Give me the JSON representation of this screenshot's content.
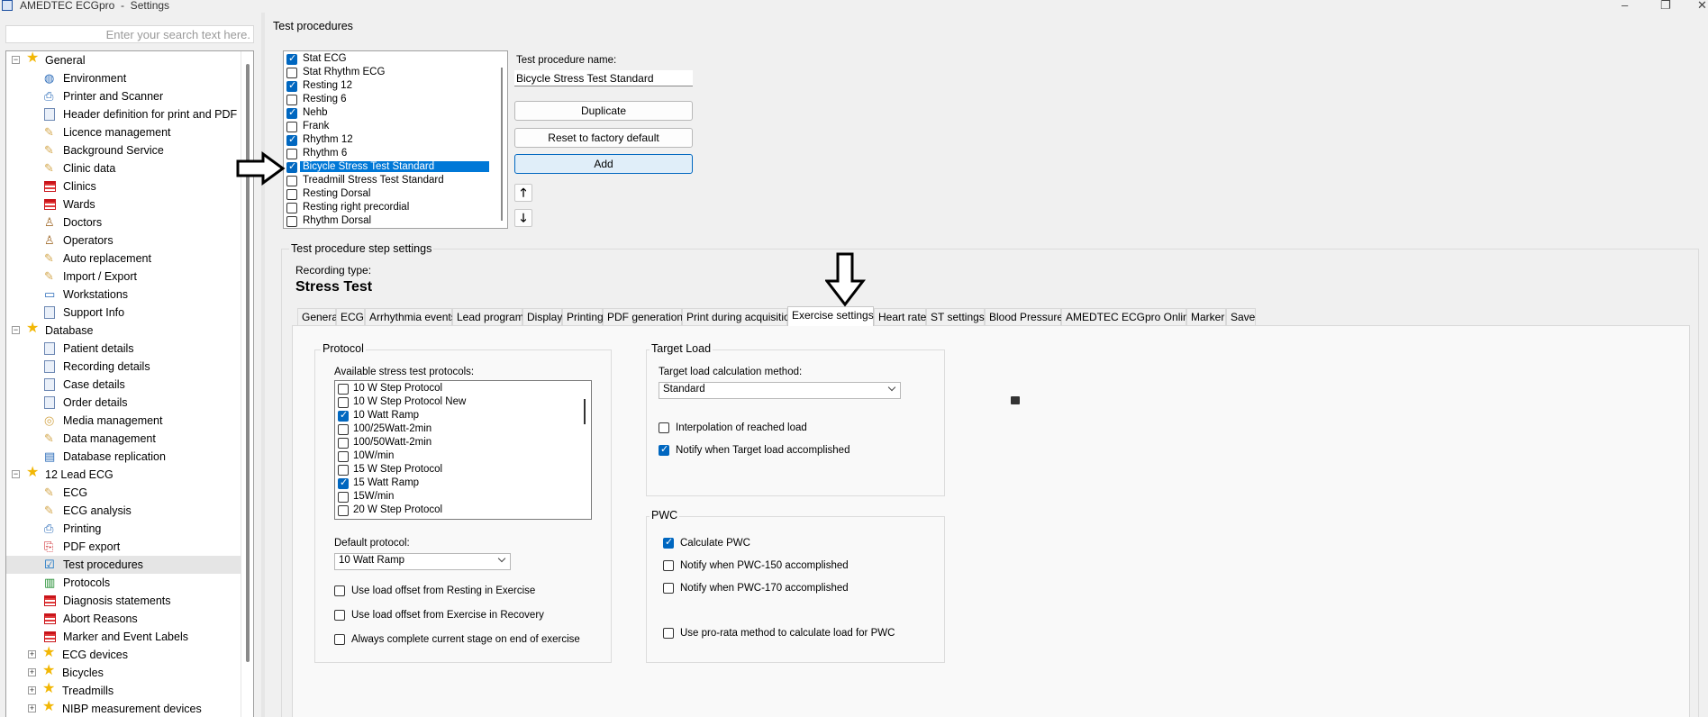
{
  "window": {
    "title": "AMEDTEC ECGpro  -  Settings",
    "controls": [
      "–",
      "❐",
      "✕"
    ]
  },
  "search": {
    "placeholder": "Enter your search text here."
  },
  "tree": {
    "items": [
      {
        "label": "General",
        "icon": "star-icon",
        "level": 0,
        "expander": "−"
      },
      {
        "label": "Environment",
        "icon": "globe-icon",
        "level": 1
      },
      {
        "label": "Printer and Scanner",
        "icon": "printer-icon",
        "level": 1
      },
      {
        "label": "Header definition for print and PDF",
        "icon": "document-icon",
        "level": 1
      },
      {
        "label": "Licence management",
        "icon": "pencil-icon",
        "level": 1
      },
      {
        "label": "Background Service",
        "icon": "pencil-icon",
        "level": 1
      },
      {
        "label": "Clinic data",
        "icon": "pencil-icon",
        "level": 1
      },
      {
        "label": "Clinics",
        "icon": "table-icon",
        "level": 1
      },
      {
        "label": "Wards",
        "icon": "table-icon",
        "level": 1
      },
      {
        "label": "Doctors",
        "icon": "person-icon",
        "level": 1
      },
      {
        "label": "Operators",
        "icon": "person-icon",
        "level": 1
      },
      {
        "label": "Auto replacement",
        "icon": "pencil-icon",
        "level": 1
      },
      {
        "label": "Import / Export",
        "icon": "pencil-icon",
        "level": 1
      },
      {
        "label": "Workstations",
        "icon": "monitor-icon",
        "level": 1
      },
      {
        "label": "Support Info",
        "icon": "document-icon",
        "level": 1
      },
      {
        "label": "Database",
        "icon": "star-icon",
        "level": 0,
        "expander": "−"
      },
      {
        "label": "Patient details",
        "icon": "document-icon",
        "level": 1
      },
      {
        "label": "Recording details",
        "icon": "document-icon",
        "level": 1
      },
      {
        "label": "Case details",
        "icon": "document-icon",
        "level": 1
      },
      {
        "label": "Order details",
        "icon": "document-icon",
        "level": 1
      },
      {
        "label": "Media management",
        "icon": "disc-icon",
        "level": 1
      },
      {
        "label": "Data management",
        "icon": "tool-icon",
        "level": 1
      },
      {
        "label": "Database replication",
        "icon": "database-icon",
        "level": 1
      },
      {
        "label": "12 Lead ECG",
        "icon": "star-icon",
        "level": 0,
        "expander": "−"
      },
      {
        "label": "ECG",
        "icon": "tool-icon",
        "level": 1
      },
      {
        "label": "ECG analysis",
        "icon": "tool-icon",
        "level": 1
      },
      {
        "label": "Printing",
        "icon": "printer-icon",
        "level": 1
      },
      {
        "label": "PDF export",
        "icon": "pdf-icon",
        "level": 1
      },
      {
        "label": "Test procedures",
        "icon": "checklist-icon",
        "level": 1,
        "selected": true
      },
      {
        "label": "Protocols",
        "icon": "chart-icon",
        "level": 1
      },
      {
        "label": "Diagnosis statements",
        "icon": "table-icon",
        "level": 1
      },
      {
        "label": "Abort Reasons",
        "icon": "table-icon",
        "level": 1
      },
      {
        "label": "Marker and Event Labels",
        "icon": "table-icon",
        "level": 1
      },
      {
        "label": "ECG devices",
        "icon": "star-icon",
        "level": 0,
        "expander": "+"
      },
      {
        "label": "Bicycles",
        "icon": "star-icon",
        "level": 0,
        "expander": "+"
      },
      {
        "label": "Treadmills",
        "icon": "star-icon",
        "level": 0,
        "expander": "+"
      },
      {
        "label": "NIBP measurement devices",
        "icon": "star-icon",
        "level": 0,
        "expander": "+"
      }
    ]
  },
  "test_procedures": {
    "group_title": "Test procedures",
    "items": [
      {
        "label": "Stat ECG",
        "checked": true
      },
      {
        "label": "Stat Rhythm ECG",
        "checked": false
      },
      {
        "label": "Resting 12",
        "checked": true
      },
      {
        "label": "Resting 6",
        "checked": false
      },
      {
        "label": "Nehb",
        "checked": true
      },
      {
        "label": "Frank",
        "checked": false
      },
      {
        "label": "Rhythm 12",
        "checked": true
      },
      {
        "label": "Rhythm 6",
        "checked": false
      },
      {
        "label": "Bicycle Stress Test Standard",
        "checked": true,
        "selected": true
      },
      {
        "label": "Treadmill Stress Test Standard",
        "checked": false
      },
      {
        "label": "Resting Dorsal",
        "checked": false
      },
      {
        "label": "Resting right precordial",
        "checked": false
      },
      {
        "label": "Rhythm Dorsal",
        "checked": false
      }
    ],
    "name_label": "Test procedure name:",
    "name_value": "Bicycle Stress Test Standard",
    "duplicate_label": "Duplicate",
    "reset_label": "Reset to factory default",
    "add_label": "Add",
    "move_up": "🡑",
    "move_down": "🡓"
  },
  "step_settings": {
    "group_title": "Test procedure step settings",
    "recording_type_label": "Recording type:",
    "recording_type_value": "Stress Test",
    "tabs": [
      "General",
      "ECG",
      "Arrhythmia events",
      "Lead program",
      "Display",
      "Printing",
      "PDF generation",
      "Print during acquisition",
      "Exercise settings",
      "Heart rate",
      "ST settings",
      "Blood Pressure",
      "AMEDTEC ECGpro Online",
      "Marker",
      "Save"
    ],
    "active_tab": "Exercise settings"
  },
  "protocol": {
    "group_title": "Protocol",
    "available_label": "Available stress test protocols:",
    "items": [
      {
        "label": "10 W Step Protocol",
        "checked": false
      },
      {
        "label": "10 W Step Protocol New",
        "checked": false
      },
      {
        "label": "10 Watt Ramp",
        "checked": true
      },
      {
        "label": "100/25Watt-2min",
        "checked": false
      },
      {
        "label": "100/50Watt-2min",
        "checked": false
      },
      {
        "label": "10W/min",
        "checked": false
      },
      {
        "label": "15 W Step Protocol",
        "checked": false
      },
      {
        "label": "15 Watt Ramp",
        "checked": true
      },
      {
        "label": "15W/min",
        "checked": false
      },
      {
        "label": "20 W Step Protocol",
        "checked": false
      }
    ],
    "default_label": "Default protocol:",
    "default_value": "10 Watt Ramp",
    "opt1": "Use load offset from Resting in Exercise",
    "opt2": "Use load offset from Exercise in Recovery",
    "opt3": "Always complete current stage on end of exercise"
  },
  "target_load": {
    "group_title": "Target Load",
    "method_label": "Target load calculation method:",
    "method_value": "Standard",
    "interp_label": "Interpolation of reached load",
    "interp_checked": false,
    "notify_label": "Notify when Target load accomplished",
    "notify_checked": true
  },
  "pwc": {
    "group_title": "PWC",
    "calc_label": "Calculate PWC",
    "calc_checked": true,
    "n150_label": "Notify when PWC-150 accomplished",
    "n170_label": "Notify when PWC-170 accomplished",
    "prorata_label": "Use pro-rata method to calculate load for PWC"
  },
  "colors": {
    "accent": "#0067c0",
    "selection": "#0078d7",
    "star": "#f2b705",
    "table_icon": "#c9141a"
  }
}
